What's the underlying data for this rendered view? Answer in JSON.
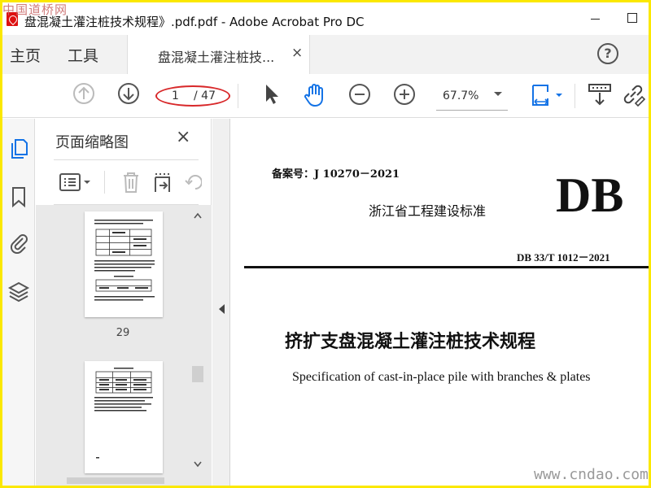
{
  "watermark": "中国道桥网",
  "window": {
    "title": "盘混凝土灌注桩技术规程》.pdf.pdf - Adobe Acrobat Pro DC"
  },
  "menu": {
    "home": "主页",
    "tools": "工具"
  },
  "tab": {
    "label": "盘混凝土灌注桩技...",
    "close": "×"
  },
  "help": "?",
  "toolbar": {
    "current_page": "1",
    "total_pages": "/ 47",
    "zoom": "67.7%"
  },
  "panel": {
    "title": "页面缩略图",
    "close": "×",
    "thumbnails": [
      {
        "page_label": "29"
      },
      {
        "page_label": ""
      }
    ]
  },
  "document": {
    "record_no": "备案号：J 10270－2021",
    "standard_type": "浙江省工程建设标准",
    "db_mark": "DB",
    "code": "DB 33/T 1012－2021",
    "title_cn": "挤扩支盘混凝土灌注桩技术规程",
    "title_en": "Specification of cast-in-place pile with branches & plates"
  },
  "site_watermark": "www.cndao.com",
  "colors": {
    "frame": "#fbe800",
    "page_highlight": "#d8282a",
    "icon": "#555555",
    "active_blue": "#1473e6"
  }
}
